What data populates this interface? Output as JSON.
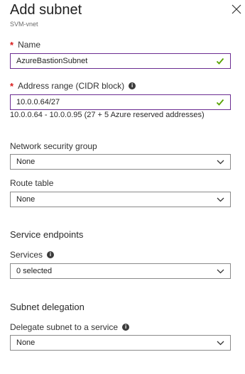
{
  "header": {
    "title": "Add subnet",
    "subtitle": "SVM-vnet"
  },
  "fields": {
    "name": {
      "label": "Name",
      "value": "AzureBastionSubnet"
    },
    "address_range": {
      "label": "Address range (CIDR block)",
      "value": "10.0.0.64/27",
      "hint": "10.0.0.64 - 10.0.0.95 (27 + 5 Azure reserved addresses)"
    },
    "nsg": {
      "label": "Network security group",
      "value": "None"
    },
    "route_table": {
      "label": "Route table",
      "value": "None"
    }
  },
  "service_endpoints": {
    "heading": "Service endpoints",
    "services_label": "Services",
    "services_value": "0 selected"
  },
  "subnet_delegation": {
    "heading": "Subnet delegation",
    "delegate_label": "Delegate subnet to a service",
    "delegate_value": "None"
  },
  "colors": {
    "required": "#d81a1a",
    "focus_border": "#6b2c91",
    "valid_check": "#57a300"
  },
  "icons": {
    "close": "close-icon",
    "info": "info-icon",
    "valid": "checkmark-icon",
    "dropdown": "chevron-down-icon"
  }
}
